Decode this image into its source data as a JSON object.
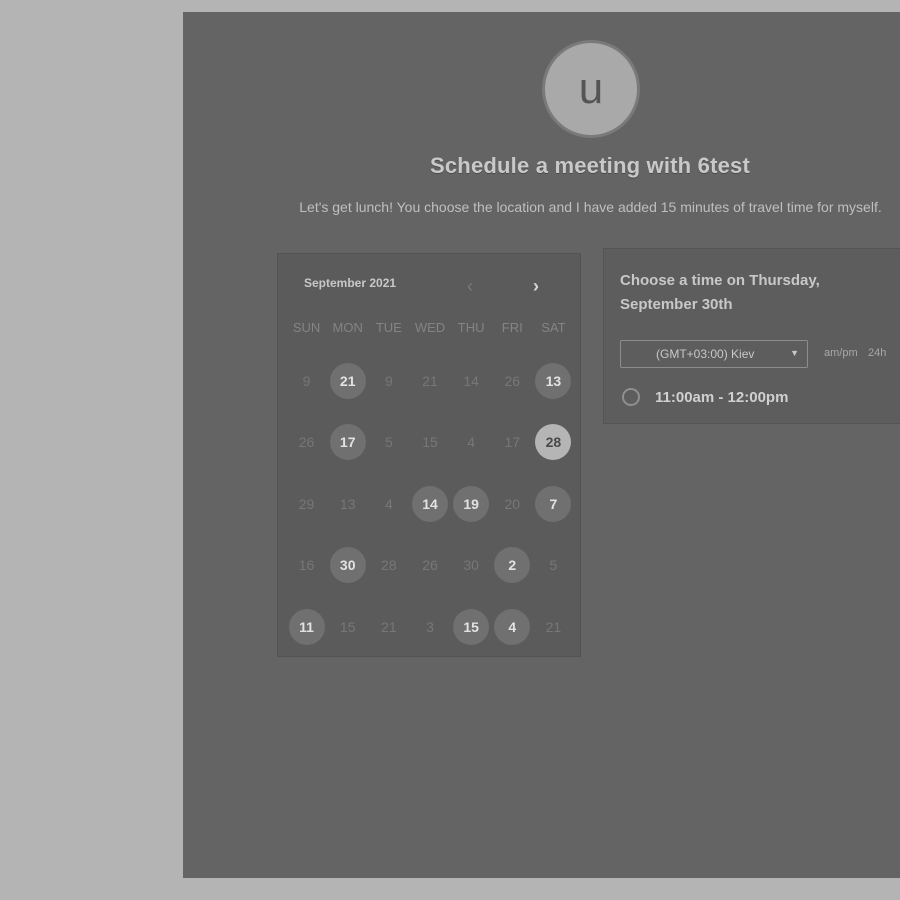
{
  "avatar_letter": "u",
  "title": "Schedule a meeting with 6test",
  "subtitle": "Let's get lunch! You choose the location and I have added 15 minutes of travel time for myself.",
  "calendar": {
    "month": "September 2021",
    "prev_icon": "chevron-left-icon",
    "next_icon": "chevron-right-icon",
    "weekdays": [
      "SUN",
      "MON",
      "TUE",
      "WED",
      "THU",
      "FRI",
      "SAT"
    ],
    "days": [
      {
        "label": "9",
        "state": "disabled"
      },
      {
        "label": "21",
        "state": "available"
      },
      {
        "label": "9",
        "state": "disabled"
      },
      {
        "label": "21",
        "state": "disabled"
      },
      {
        "label": "14",
        "state": "disabled"
      },
      {
        "label": "26",
        "state": "disabled"
      },
      {
        "label": "13",
        "state": "available"
      },
      {
        "label": "26",
        "state": "disabled"
      },
      {
        "label": "17",
        "state": "available"
      },
      {
        "label": "5",
        "state": "disabled"
      },
      {
        "label": "15",
        "state": "disabled"
      },
      {
        "label": "4",
        "state": "disabled"
      },
      {
        "label": "17",
        "state": "disabled"
      },
      {
        "label": "28",
        "state": "selected"
      },
      {
        "label": "29",
        "state": "disabled"
      },
      {
        "label": "13",
        "state": "disabled"
      },
      {
        "label": "4",
        "state": "disabled"
      },
      {
        "label": "14",
        "state": "available"
      },
      {
        "label": "19",
        "state": "available"
      },
      {
        "label": "20",
        "state": "disabled"
      },
      {
        "label": "7",
        "state": "available"
      },
      {
        "label": "16",
        "state": "disabled"
      },
      {
        "label": "30",
        "state": "available"
      },
      {
        "label": "28",
        "state": "disabled"
      },
      {
        "label": "26",
        "state": "disabled"
      },
      {
        "label": "30",
        "state": "disabled"
      },
      {
        "label": "2",
        "state": "available"
      },
      {
        "label": "5",
        "state": "disabled"
      },
      {
        "label": "11",
        "state": "available"
      },
      {
        "label": "15",
        "state": "disabled"
      },
      {
        "label": "21",
        "state": "disabled"
      },
      {
        "label": "3",
        "state": "disabled"
      },
      {
        "label": "15",
        "state": "available"
      },
      {
        "label": "4",
        "state": "available"
      },
      {
        "label": "21",
        "state": "disabled"
      }
    ]
  },
  "times": {
    "heading": "Choose a time on Thursday, September 30th",
    "timezone": "(GMT+03:00) Kiev",
    "format_ampm": "am/pm",
    "format_24h": "24h",
    "slots": [
      "11:00am - 12:00pm"
    ]
  }
}
